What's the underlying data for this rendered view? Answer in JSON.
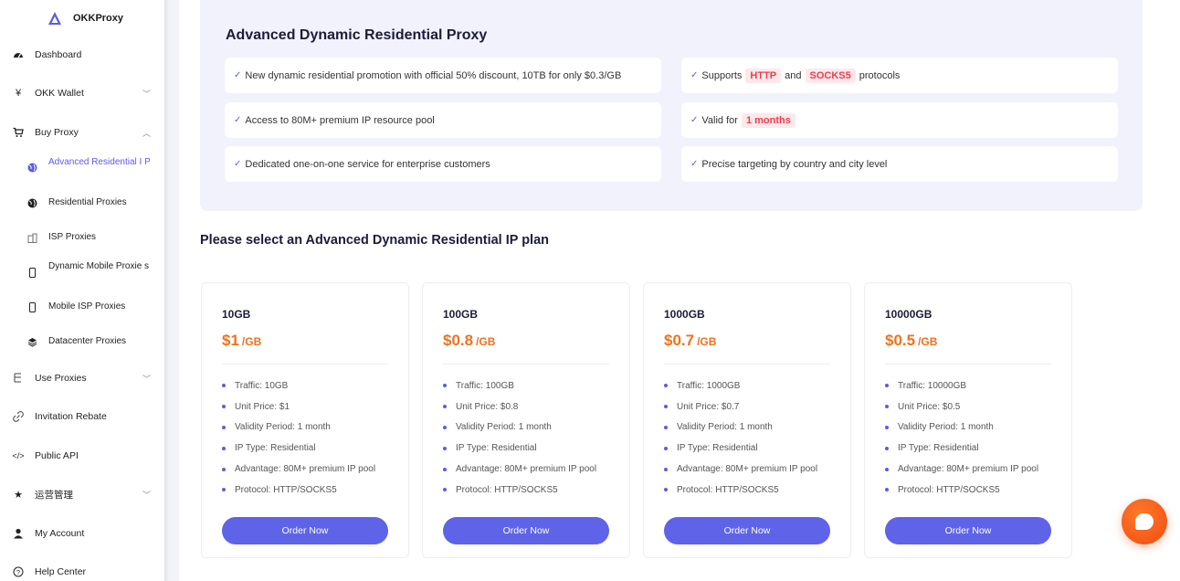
{
  "app": {
    "name": "OKKProxy",
    "accent": "#5b5ce6",
    "price_color": "#f2711c",
    "tag_color": "#f03c4e"
  },
  "sidebar": {
    "items": [
      {
        "label": "Dashboard",
        "icon": "dashboard-icon"
      },
      {
        "label": "OKK Wallet",
        "icon": "yen-icon"
      },
      {
        "label": "Buy Proxy",
        "icon": "cart-icon"
      },
      {
        "label": "Use Proxies",
        "icon": "tree-icon"
      },
      {
        "label": "Invitation Rebate",
        "icon": "link-icon"
      },
      {
        "label": "Public API",
        "icon": "code-icon"
      },
      {
        "label": "运营管理",
        "icon": "star-icon"
      },
      {
        "label": "My Account",
        "icon": "user-icon"
      },
      {
        "label": "Help Center",
        "icon": "help-icon"
      }
    ],
    "sub_items": [
      {
        "label": "Advanced Residential I P",
        "icon": "globe-icon"
      },
      {
        "label": "Residential Proxies",
        "icon": "globe-icon"
      },
      {
        "label": "ISP Proxies",
        "icon": "building-icon"
      },
      {
        "label": "Dynamic Mobile Proxie s",
        "icon": "mobile-icon"
      },
      {
        "label": "Mobile ISP Proxies",
        "icon": "mobile-icon"
      },
      {
        "label": "Datacenter Proxies",
        "icon": "database-icon"
      }
    ]
  },
  "hero": {
    "title": "Advanced Dynamic Residential Proxy",
    "features": {
      "f1": "New dynamic residential promotion with official 50% discount, 10TB for only $0.3/GB",
      "f2_pre": "Supports",
      "f2_tag1": "HTTP",
      "f2_mid": "and",
      "f2_tag2": "SOCKS5",
      "f2_post": "protocols",
      "f3": "Access to 80M+ premium IP resource pool",
      "f4_pre": "Valid for",
      "f4_tag": "1 months",
      "f5": "Dedicated one-on-one service for enterprise customers",
      "f6": "Precise targeting by country and city level"
    }
  },
  "section_title": "Please select an Advanced Dynamic Residential IP plan",
  "plans": [
    {
      "name": "10GB",
      "price": "$1",
      "unit": "/GB",
      "details": [
        "Traffic: 10GB",
        "Unit Price: $1",
        "Validity Period: 1 month",
        "IP Type: Residential",
        "Advantage: 80M+ premium IP pool",
        "Protocol: HTTP/SOCKS5"
      ],
      "button": "Order Now"
    },
    {
      "name": "100GB",
      "price": "$0.8",
      "unit": "/GB",
      "details": [
        "Traffic: 100GB",
        "Unit Price: $0.8",
        "Validity Period: 1 month",
        "IP Type: Residential",
        "Advantage: 80M+ premium IP pool",
        "Protocol: HTTP/SOCKS5"
      ],
      "button": "Order Now"
    },
    {
      "name": "1000GB",
      "price": "$0.7",
      "unit": "/GB",
      "details": [
        "Traffic: 1000GB",
        "Unit Price: $0.7",
        "Validity Period: 1 month",
        "IP Type: Residential",
        "Advantage: 80M+ premium IP pool",
        "Protocol: HTTP/SOCKS5"
      ],
      "button": "Order Now"
    },
    {
      "name": "10000GB",
      "price": "$0.5",
      "unit": "/GB",
      "details": [
        "Traffic: 10000GB",
        "Unit Price: $0.5",
        "Validity Period: 1 month",
        "IP Type: Residential",
        "Advantage: 80M+ premium IP pool",
        "Protocol: HTTP/SOCKS5"
      ],
      "button": "Order Now"
    }
  ]
}
